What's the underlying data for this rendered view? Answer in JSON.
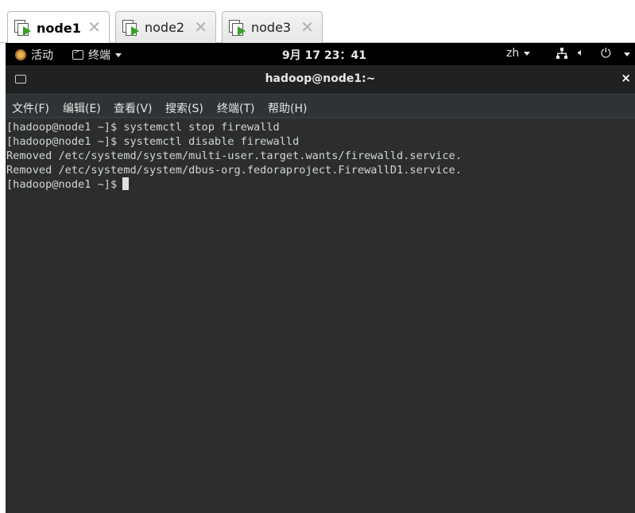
{
  "tabs": [
    {
      "label": "node1",
      "active": true
    },
    {
      "label": "node2",
      "active": false
    },
    {
      "label": "node3",
      "active": false
    }
  ],
  "tab_close_glyph": "✕",
  "topbar": {
    "activities": "活动",
    "app_name": "终端",
    "clock": "9月 17  23：41",
    "input_method": "zh",
    "icons": [
      "network-icon",
      "volume-icon",
      "power-icon"
    ]
  },
  "window": {
    "title": "hadoop@node1:~",
    "close_glyph": "×"
  },
  "menu": [
    "文件(F)",
    "编辑(E)",
    "查看(V)",
    "搜索(S)",
    "终端(T)",
    "帮助(H)"
  ],
  "terminal": {
    "lines": [
      "[hadoop@node1 ~]$ systemctl stop firewalld",
      "[hadoop@node1 ~]$ systemctl disable firewalld",
      "Removed /etc/systemd/system/multi-user.target.wants/firewalld.service.",
      "Removed /etc/systemd/system/dbus-org.fedoraproject.FirewallD1.service."
    ],
    "prompt": "[hadoop@node1 ~]$"
  },
  "colors": {
    "terminal_bg": "#2b2d2e",
    "terminal_fg": "#d3d7cf",
    "topbar_bg": "#000000",
    "play_green": "#3aa12b"
  }
}
